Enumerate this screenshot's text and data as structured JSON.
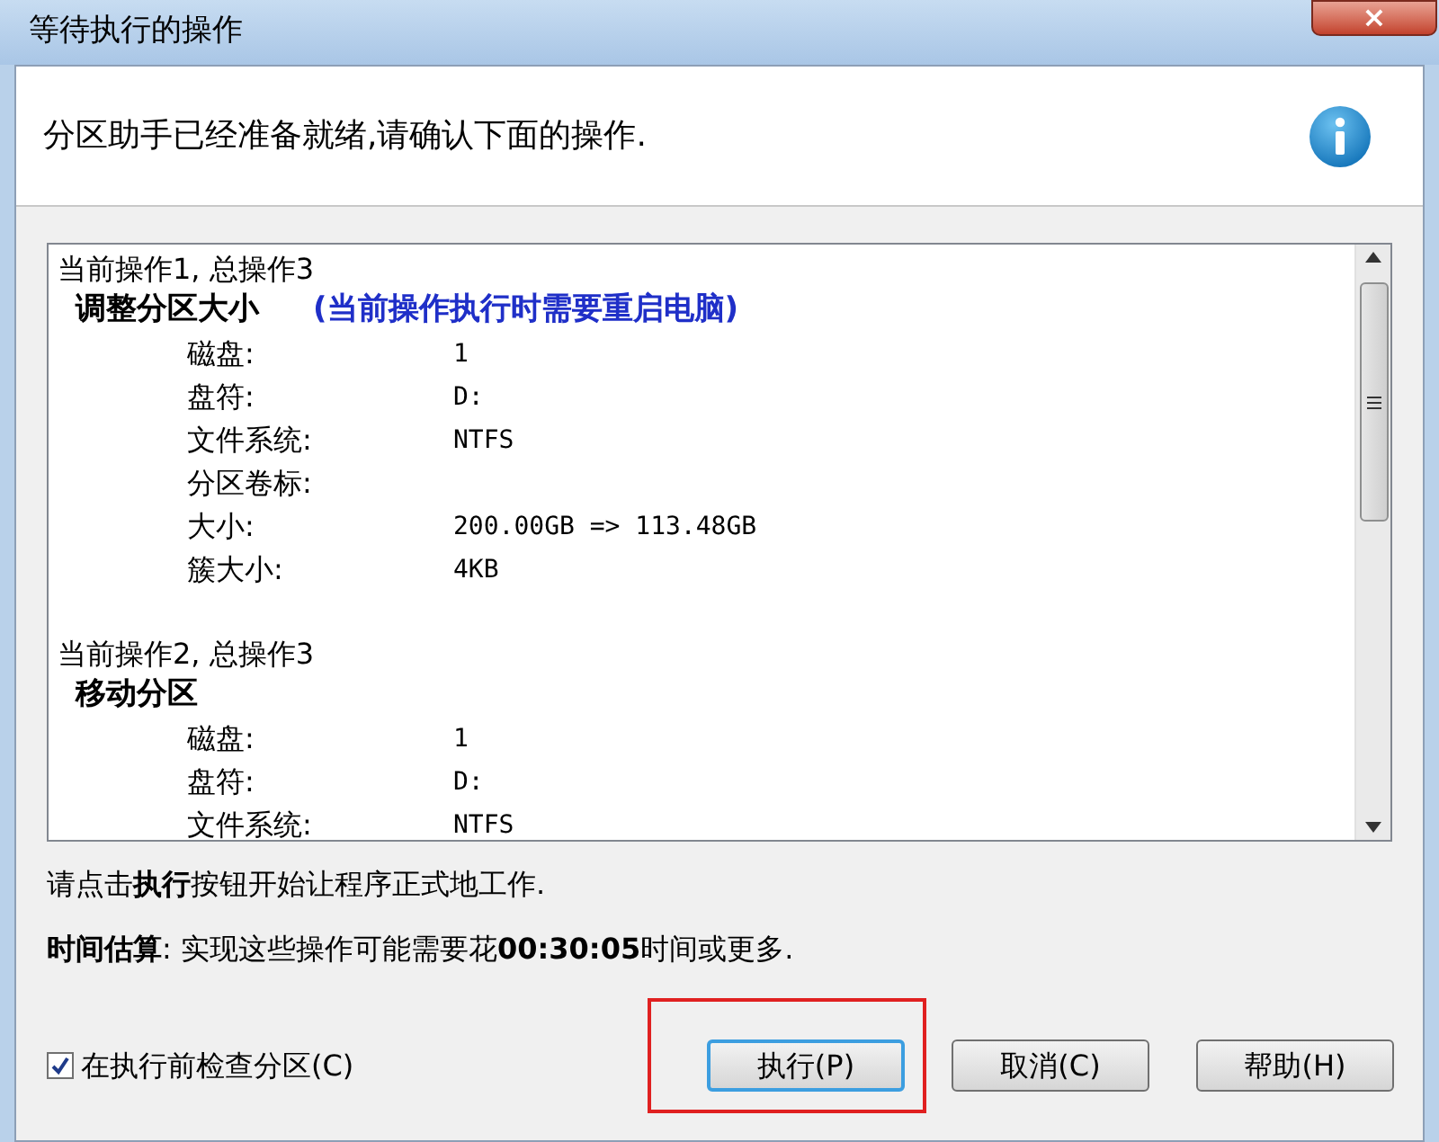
{
  "window": {
    "title": "等待执行的操作",
    "close": "×"
  },
  "header": {
    "message": "分区助手已经准备就绪,请确认下面的操作."
  },
  "operations": [
    {
      "header": "当前操作1, 总操作3",
      "title": "调整分区大小",
      "note": "(当前操作执行时需要重启电脑)",
      "fields": [
        {
          "label": "磁盘:",
          "value": "1"
        },
        {
          "label": "盘符:",
          "value": "D:"
        },
        {
          "label": "文件系统:",
          "value": "NTFS"
        },
        {
          "label": "分区卷标:"
        },
        {
          "label": "大小:",
          "value": "200.00GB => 113.48GB"
        },
        {
          "label": "簇大小:",
          "value": "4KB"
        }
      ]
    },
    {
      "header": "当前操作2, 总操作3",
      "title": "移动分区",
      "fields": [
        {
          "label": "磁盘:",
          "value": "1"
        },
        {
          "label": "盘符:",
          "value": "D:"
        },
        {
          "label": "文件系统:",
          "value": "NTFS"
        }
      ]
    }
  ],
  "instruction": "请点击**执行**按钮开始让程序正式地工作.",
  "estimate": "**时间估算**: 实现这些操作可能需要花**00:30:05**时间或更多.",
  "check_partition": {
    "label": "在执行前检查分区(C)",
    "checked": true
  },
  "buttons": [
    {
      "label": "执行(P)",
      "highlighted": true,
      "focused": true
    },
    {
      "label": "取消(C)",
      "highlighted": false,
      "focused": false
    },
    {
      "label": "帮助(H)",
      "highlighted": false,
      "focused": false
    }
  ]
}
